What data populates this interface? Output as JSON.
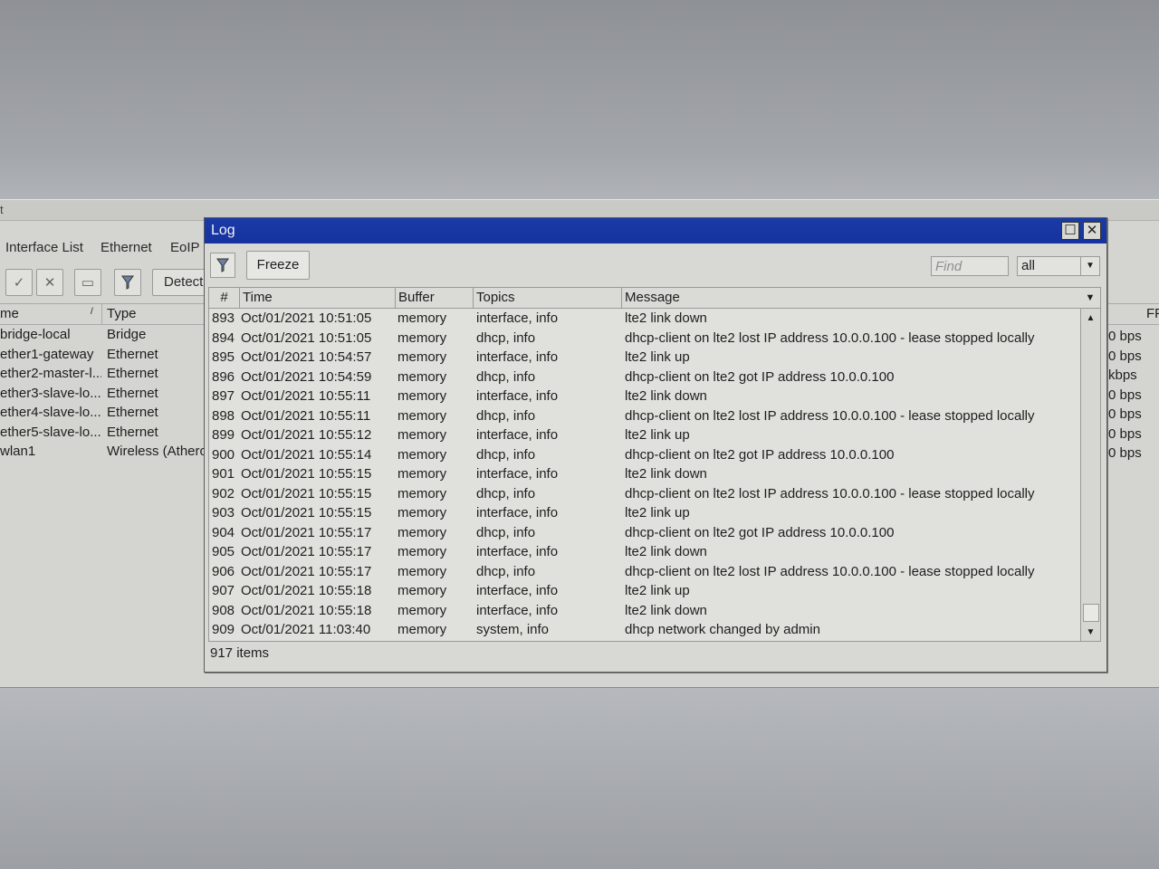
{
  "bg_window": {
    "title": "t",
    "tabs": [
      "Interface List",
      "Ethernet",
      "EoIP"
    ],
    "detect_label": "Detect",
    "columns": {
      "name": "me",
      "type": "Type",
      "right": "FF"
    },
    "rows": [
      {
        "name": "bridge-local",
        "type": "Bridge",
        "rate": "0 bps"
      },
      {
        "name": "ether1-gateway",
        "type": "Ethernet",
        "rate": "0 bps"
      },
      {
        "name": "ether2-master-l...",
        "type": "Ethernet",
        "rate": "kbps"
      },
      {
        "name": "ether3-slave-lo...",
        "type": "Ethernet",
        "rate": "0 bps"
      },
      {
        "name": "ether4-slave-lo...",
        "type": "Ethernet",
        "rate": "0 bps"
      },
      {
        "name": "ether5-slave-lo...",
        "type": "Ethernet",
        "rate": "0 bps"
      },
      {
        "name": "wlan1",
        "type": "Wireless (Athero",
        "rate": "0 bps"
      }
    ]
  },
  "log": {
    "title": "Log",
    "freeze_label": "Freeze",
    "find_placeholder": "Find",
    "filter_value": "all",
    "columns": {
      "num": "#",
      "time": "Time",
      "buffer": "Buffer",
      "topics": "Topics",
      "message": "Message"
    },
    "entries": [
      {
        "num": "893",
        "time": "Oct/01/2021 10:51:05",
        "buffer": "memory",
        "topics": "interface, info",
        "message": "lte2 link down"
      },
      {
        "num": "894",
        "time": "Oct/01/2021 10:51:05",
        "buffer": "memory",
        "topics": "dhcp, info",
        "message": "dhcp-client on lte2 lost IP address 10.0.0.100 - lease stopped locally"
      },
      {
        "num": "895",
        "time": "Oct/01/2021 10:54:57",
        "buffer": "memory",
        "topics": "interface, info",
        "message": "lte2 link up"
      },
      {
        "num": "896",
        "time": "Oct/01/2021 10:54:59",
        "buffer": "memory",
        "topics": "dhcp, info",
        "message": "dhcp-client on lte2 got IP address 10.0.0.100"
      },
      {
        "num": "897",
        "time": "Oct/01/2021 10:55:11",
        "buffer": "memory",
        "topics": "interface, info",
        "message": "lte2 link down"
      },
      {
        "num": "898",
        "time": "Oct/01/2021 10:55:11",
        "buffer": "memory",
        "topics": "dhcp, info",
        "message": "dhcp-client on lte2 lost IP address 10.0.0.100 - lease stopped locally"
      },
      {
        "num": "899",
        "time": "Oct/01/2021 10:55:12",
        "buffer": "memory",
        "topics": "interface, info",
        "message": "lte2 link up"
      },
      {
        "num": "900",
        "time": "Oct/01/2021 10:55:14",
        "buffer": "memory",
        "topics": "dhcp, info",
        "message": "dhcp-client on lte2 got IP address 10.0.0.100"
      },
      {
        "num": "901",
        "time": "Oct/01/2021 10:55:15",
        "buffer": "memory",
        "topics": "interface, info",
        "message": "lte2 link down"
      },
      {
        "num": "902",
        "time": "Oct/01/2021 10:55:15",
        "buffer": "memory",
        "topics": "dhcp, info",
        "message": "dhcp-client on lte2 lost IP address 10.0.0.100 - lease stopped locally"
      },
      {
        "num": "903",
        "time": "Oct/01/2021 10:55:15",
        "buffer": "memory",
        "topics": "interface, info",
        "message": "lte2 link up"
      },
      {
        "num": "904",
        "time": "Oct/01/2021 10:55:17",
        "buffer": "memory",
        "topics": "dhcp, info",
        "message": "dhcp-client on lte2 got IP address 10.0.0.100"
      },
      {
        "num": "905",
        "time": "Oct/01/2021 10:55:17",
        "buffer": "memory",
        "topics": "interface, info",
        "message": "lte2 link down"
      },
      {
        "num": "906",
        "time": "Oct/01/2021 10:55:17",
        "buffer": "memory",
        "topics": "dhcp, info",
        "message": "dhcp-client on lte2 lost IP address 10.0.0.100 - lease stopped locally"
      },
      {
        "num": "907",
        "time": "Oct/01/2021 10:55:18",
        "buffer": "memory",
        "topics": "interface, info",
        "message": "lte2 link up"
      },
      {
        "num": "908",
        "time": "Oct/01/2021 10:55:18",
        "buffer": "memory",
        "topics": "interface, info",
        "message": "lte2 link down"
      },
      {
        "num": "909",
        "time": "Oct/01/2021 11:03:40",
        "buffer": "memory",
        "topics": "system, info",
        "message": "dhcp network changed by admin"
      }
    ],
    "status": "917 items"
  },
  "icons": {
    "enable": "check-icon",
    "disable": "cross-icon",
    "comment": "comment-icon",
    "filter": "funnel-icon",
    "maximize": "maximize-icon",
    "close": "close-icon"
  },
  "colors": {
    "titlebar": "#1633a0",
    "window_bg": "#d8d8d4",
    "grid_bg": "#e0e0dc"
  }
}
